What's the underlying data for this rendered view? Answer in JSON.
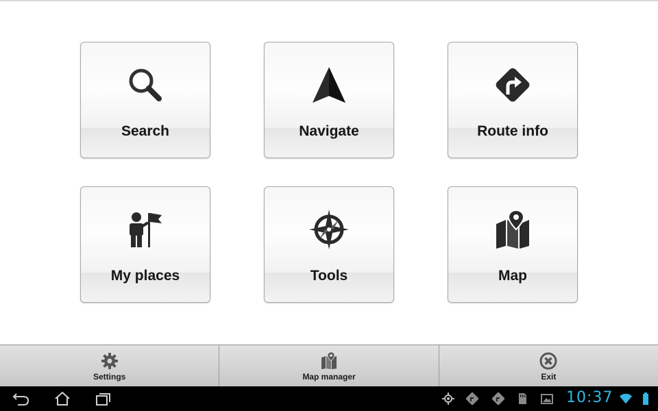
{
  "menu": {
    "tiles": [
      {
        "label": "Search",
        "icon": "magnifier-icon"
      },
      {
        "label": "Navigate",
        "icon": "navigation-arrow-icon"
      },
      {
        "label": "Route info",
        "icon": "turn-sign-icon"
      },
      {
        "label": "My places",
        "icon": "person-flag-icon"
      },
      {
        "label": "Tools",
        "icon": "compass-rose-icon"
      },
      {
        "label": "Map",
        "icon": "map-pin-icon"
      }
    ]
  },
  "bottom_bar": {
    "settings": "Settings",
    "map_manager": "Map manager",
    "exit": "Exit"
  },
  "system_bar": {
    "clock": "10:37",
    "clock_color": "#33b5e5"
  }
}
